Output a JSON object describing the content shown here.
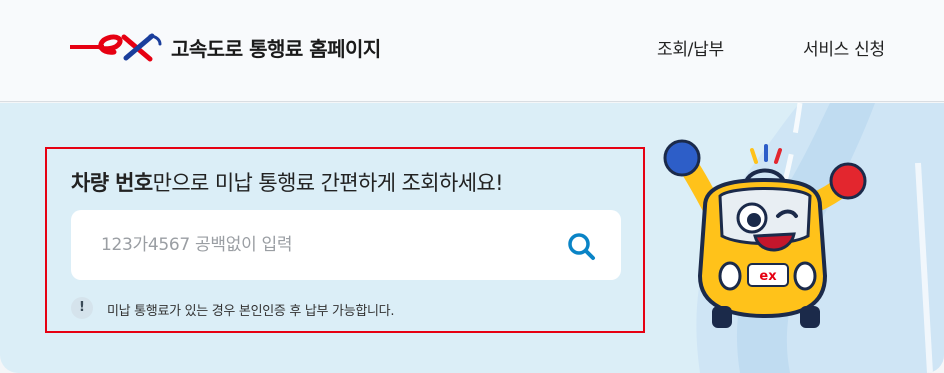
{
  "header": {
    "logo_text": "ex",
    "site_title": "고속도로 통행료 홈페이지",
    "nav": [
      {
        "label": "조회/납부"
      },
      {
        "label": "서비스 신청"
      }
    ]
  },
  "search": {
    "headline_bold": "차량 번호",
    "headline_rest": "만으로 미납 통행료 간편하게 조회하세요!",
    "placeholder": "123가4567 공백없이 입력",
    "value": "",
    "button_icon": "search-icon",
    "notice_icon": "exclamation-icon",
    "notice_text": "미납 통행료가 있는 경우 본인인증 후 납부 가능합니다."
  },
  "mascot": {
    "badge_text": "ex"
  },
  "colors": {
    "brand_red": "#e60012",
    "brand_blue": "#1a3e9c",
    "accent_blue": "#0a84c6",
    "hero_bg": "#dbeef7",
    "highlight_border": "#e60012",
    "mascot_yellow": "#ffc21a"
  }
}
